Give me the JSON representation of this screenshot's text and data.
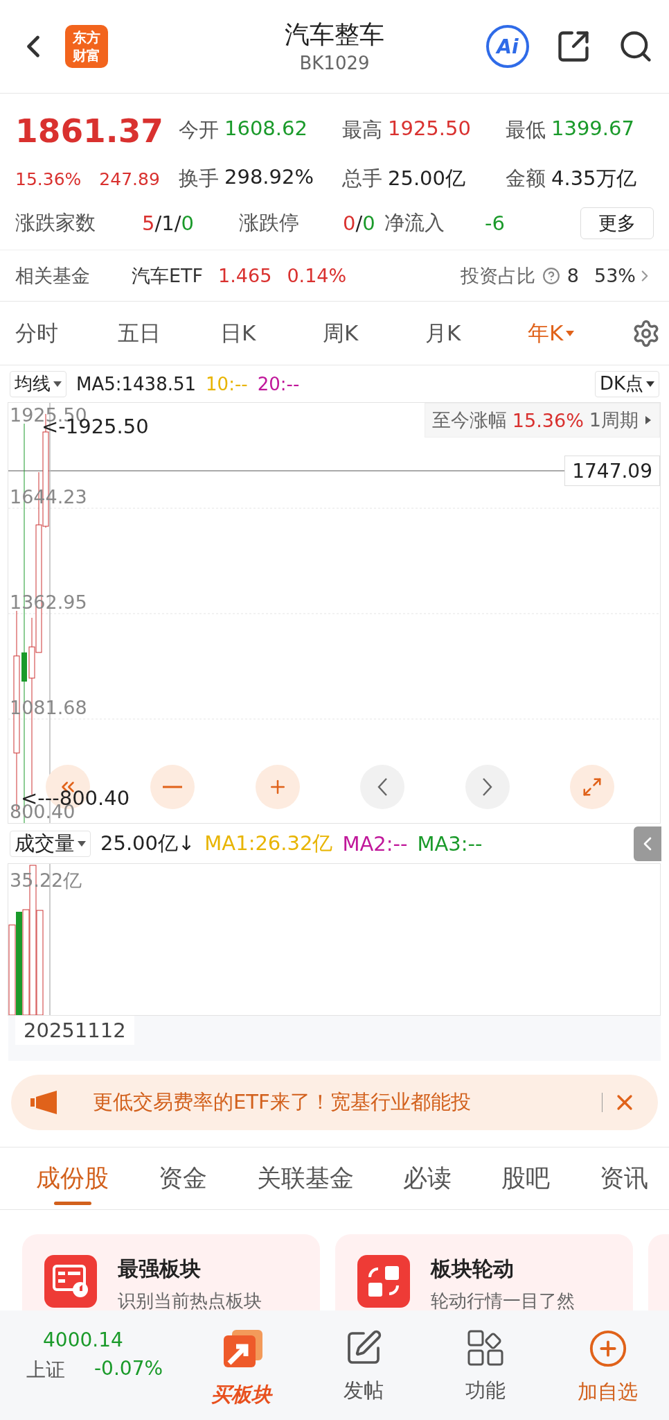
{
  "header": {
    "logo": "东方财富",
    "title": "汽车整车",
    "code": "BK1029",
    "ai_badge": "Ai"
  },
  "quote": {
    "price": "1861.37",
    "change_pct": "15.36%",
    "change_amt": "247.89",
    "stats": [
      {
        "label": "今开",
        "value": "1608.62",
        "color": "#1a9a2a"
      },
      {
        "label": "最高",
        "value": "1925.50",
        "color": "#d9312f"
      },
      {
        "label": "最低",
        "value": "1399.67",
        "color": "#1a9a2a"
      },
      {
        "label": "换手",
        "value": "298.92%",
        "color": "#222222"
      },
      {
        "label": "总手",
        "value": "25.00亿",
        "color": "#222222"
      },
      {
        "label": "金额",
        "value": "4.35万亿",
        "color": "#222222"
      }
    ],
    "breadth": [
      {
        "label": "涨跌家数",
        "parts": [
          {
            "text": "5",
            "color": "#d9312f"
          },
          {
            "text": "/1/",
            "color": "#222222"
          },
          {
            "text": "0",
            "color": "#1a9a2a"
          }
        ]
      },
      {
        "label": "涨跌停",
        "parts": [
          {
            "text": "0",
            "color": "#d9312f"
          },
          {
            "text": "/",
            "color": "#222222"
          },
          {
            "text": "0",
            "color": "#1a9a2a"
          }
        ]
      },
      {
        "label": "净流入",
        "parts": [
          {
            "text": "-6",
            "color": "#1a9a2a"
          }
        ]
      }
    ],
    "more_button": "更多"
  },
  "fund": {
    "label": "相关基金",
    "name": "汽车ETF",
    "price": "1.465",
    "change": "0.14%",
    "ratio_label": "投资占比",
    "ratio_head": "8",
    "ratio_tail": "53%"
  },
  "period_tabs": [
    {
      "label": "分时",
      "selected": false,
      "dropdown": false
    },
    {
      "label": "五日",
      "selected": false,
      "dropdown": false
    },
    {
      "label": "日K",
      "selected": false,
      "dropdown": false
    },
    {
      "label": "周K",
      "selected": false,
      "dropdown": false
    },
    {
      "label": "月K",
      "selected": false,
      "dropdown": false
    },
    {
      "label": "年K",
      "selected": true,
      "dropdown": true
    }
  ],
  "ma_bar": {
    "selector": "均线",
    "items": [
      {
        "text": "MA5:1438.51",
        "color": "#222222"
      },
      {
        "text": "10:--",
        "color": "#e8b400"
      },
      {
        "text": "20:--",
        "color": "#c0179a"
      }
    ],
    "right_selector": "DK点"
  },
  "price_chart": {
    "y_labels": [
      "1925.50",
      "1644.23",
      "1362.95",
      "1081.68",
      "800.40"
    ],
    "high_marker": "<-1925.50",
    "low_marker": "<---800.40",
    "last_price": "1747.09",
    "range_box": {
      "label": "至今涨幅",
      "value": "15.36%",
      "period": "1周期"
    },
    "controls": [
      {
        "kind": "first"
      },
      {
        "kind": "zoom-out"
      },
      {
        "kind": "zoom-in"
      },
      {
        "kind": "prev"
      },
      {
        "kind": "next"
      },
      {
        "kind": "expand"
      }
    ]
  },
  "volume": {
    "selector": "成交量",
    "value": "25.00亿↓",
    "items": [
      {
        "text": "MA1:26.32亿",
        "color": "#e8b400"
      },
      {
        "text": "MA2:--",
        "color": "#c0179a"
      },
      {
        "text": "MA3:--",
        "color": "#1a9a2a"
      }
    ],
    "y_label": "35.22亿",
    "date": "20251112"
  },
  "banner": {
    "text": "更低交易费率的ETF来了！宽基行业都能投"
  },
  "section_tabs": [
    {
      "label": "成份股",
      "selected": true
    },
    {
      "label": "资金",
      "selected": false
    },
    {
      "label": "关联基金",
      "selected": false
    },
    {
      "label": "必读",
      "selected": false
    },
    {
      "label": "股吧",
      "selected": false
    },
    {
      "label": "资讯",
      "selected": false
    }
  ],
  "cards": [
    {
      "kind": "ranking",
      "title": "最强板块",
      "subtitle": "识别当前热点板块"
    },
    {
      "kind": "rotation",
      "title": "板块轮动",
      "subtitle": "轮动行情一目了然"
    }
  ],
  "bottom_nav": {
    "index": {
      "price": "4000.14",
      "name": "上证",
      "change": "-0.07%"
    },
    "items": [
      {
        "kind": "buy",
        "label": "买板块"
      },
      {
        "kind": "post",
        "label": "发帖"
      },
      {
        "kind": "apps",
        "label": "功能"
      },
      {
        "kind": "add",
        "label": "加自选"
      }
    ]
  }
}
